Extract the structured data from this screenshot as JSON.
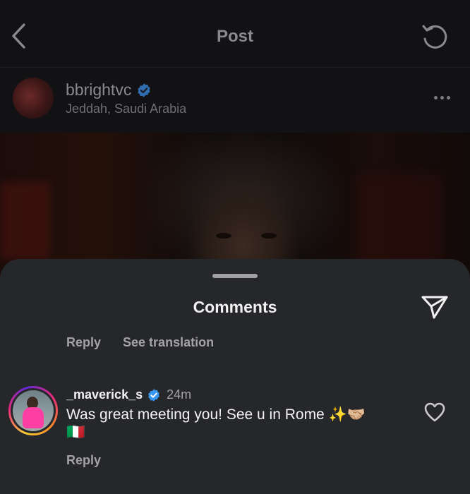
{
  "header": {
    "title": "Post",
    "back_icon": "chevron-left-icon",
    "refresh_icon": "refresh-icon"
  },
  "post": {
    "author": {
      "username": "bbrightvc",
      "verified": true,
      "location": "Jeddah, Saudi Arabia"
    },
    "more_icon": "more-horizontal-icon"
  },
  "comments_sheet": {
    "title": "Comments",
    "share_icon": "send-icon",
    "previous_comment": {
      "reply_label": "Reply",
      "translation_label": "See translation"
    },
    "comments": [
      {
        "username": "_maverick_s",
        "verified": true,
        "time": "24m",
        "text": "Was great meeting you! See u in Rome ✨🤝🏼",
        "text_line2": "🇮🇹",
        "reply_label": "Reply",
        "like_icon": "heart-outline-icon"
      }
    ]
  },
  "colors": {
    "verified_badge": "#3797f0",
    "sheet_background": "#26272b",
    "secondary_text": "#a2a2a7"
  }
}
